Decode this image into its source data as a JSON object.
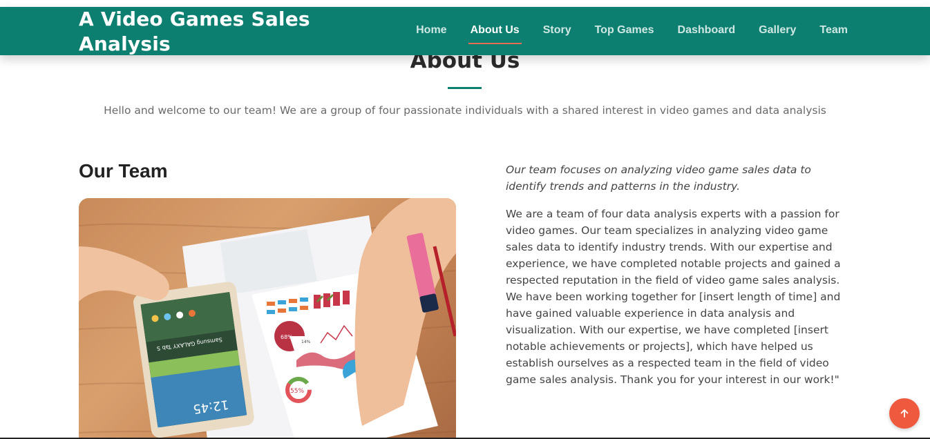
{
  "header": {
    "logo": "A Video Games Sales Analysis",
    "nav": [
      {
        "label": "Home",
        "active": false
      },
      {
        "label": "About Us",
        "active": true
      },
      {
        "label": "Story",
        "active": false
      },
      {
        "label": "Top Games",
        "active": false
      },
      {
        "label": "Dashboard",
        "active": false
      },
      {
        "label": "Gallery",
        "active": false
      },
      {
        "label": "Team",
        "active": false
      }
    ]
  },
  "about": {
    "title": "About Us",
    "intro": "Hello and welcome to our team! We are a group of four passionate individuals with a shared interest in video games and data analysis"
  },
  "team": {
    "heading": "Our Team",
    "tagline": "Our team focuses on analyzing video game sales data to identify trends and patterns in the industry.",
    "body": "We are a team of four data analysis experts with a passion for video games. Our team specializes in analyzing video game sales data to identify industry trends. With our expertise and experience, we have completed notable projects and gained a respected reputation in the field of video game sales analysis. We have been working together for [insert length of time] and have gained valuable experience in data analysis and visualization. With our expertise, we have completed [insert notable achievements or projects], which have helped us establish ourselves as a respected team in the field of video game sales analysis. Thank you for your interest in our work!\"",
    "photo": {
      "tablet_brand": "Samsung GALAXY Tab S",
      "tablet_time": "12:45",
      "chart_values": [
        "68%",
        "14%",
        "55%"
      ]
    }
  },
  "colors": {
    "header_bg": "#0d7f70",
    "nav_active_underline": "#e96b56",
    "back_to_top_bg": "#ef5a3e"
  },
  "icons": {
    "back_to_top": "arrow-up-icon"
  }
}
